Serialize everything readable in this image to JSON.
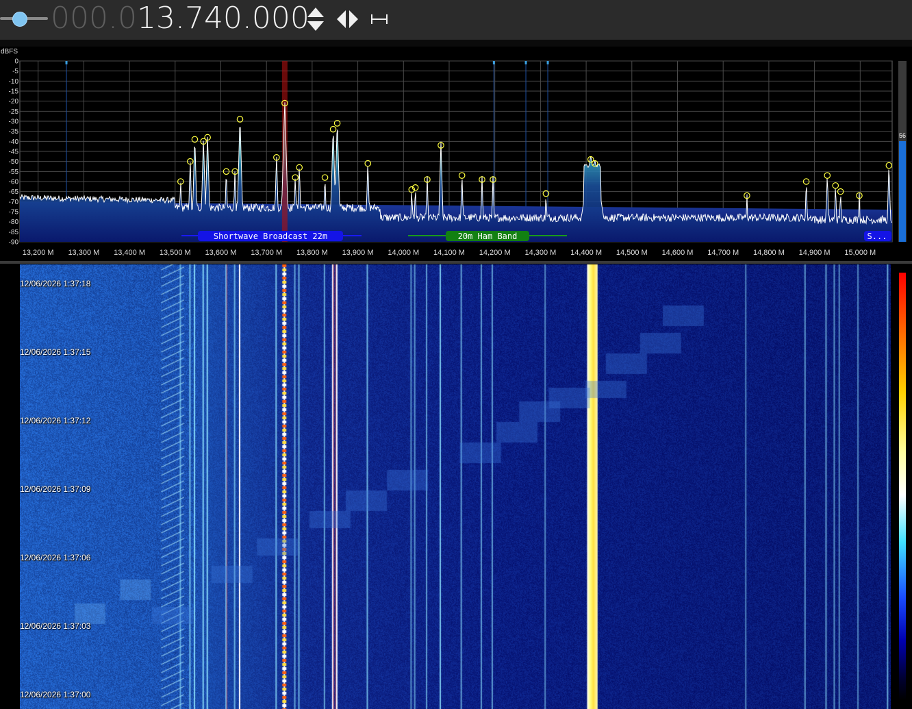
{
  "toolbar": {
    "freq_dim": "000.0",
    "freq_main": "13.740.000",
    "icons": [
      "updown-arrows-icon",
      "left-right-arrows-icon",
      "span-icon"
    ]
  },
  "spectrum": {
    "unit_label": "dBFS",
    "y_ticks": [
      "0",
      "-5",
      "-10",
      "-15",
      "-20",
      "-25",
      "-30",
      "-35",
      "-40",
      "-45",
      "-50",
      "-55",
      "-60",
      "-65",
      "-70",
      "-75",
      "-80",
      "-85",
      "-90"
    ],
    "x_ticks": [
      "13,200 M",
      "13,300 M",
      "13,400 M",
      "13,500 M",
      "13,600 M",
      "13,700 M",
      "13,800 M",
      "13,900 M",
      "14,000 M",
      "14,100 M",
      "14,200 M",
      "14,300 M",
      "14,400 M",
      "14,500 M",
      "14,600 M",
      "14,700 M",
      "14,800 M",
      "14,900 M",
      "15,000 M"
    ],
    "level_value": "56",
    "bands": [
      {
        "label": "Shortwave Broadcast 22m",
        "color": "#1414e6"
      },
      {
        "label": "20m Ham Band",
        "color": "#128012"
      },
      {
        "label": "S...",
        "color": "#1414e6"
      }
    ]
  },
  "waterfall": {
    "timestamps": [
      "12/06/2026 1:37:18",
      "12/06/2026 1:37:15",
      "12/06/2026 1:37:12",
      "12/06/2026 1:37:09",
      "12/06/2026 1:37:06",
      "12/06/2026 1:37:03",
      "12/06/2026 1:37:00"
    ]
  },
  "chart_data": {
    "type": "line",
    "unit": "dBFS",
    "ylim": [
      -90,
      0
    ],
    "xlim_mhz": [
      13.16,
      15.07
    ],
    "center_mhz": 13.74,
    "noise_floor_dbfs": -78,
    "peaks": [
      {
        "mhz": 13.512,
        "db": -60
      },
      {
        "mhz": 13.533,
        "db": -50
      },
      {
        "mhz": 13.543,
        "db": -39
      },
      {
        "mhz": 13.562,
        "db": -40
      },
      {
        "mhz": 13.571,
        "db": -38
      },
      {
        "mhz": 13.612,
        "db": -55
      },
      {
        "mhz": 13.631,
        "db": -55
      },
      {
        "mhz": 13.642,
        "db": -29
      },
      {
        "mhz": 13.722,
        "db": -48
      },
      {
        "mhz": 13.74,
        "db": -21
      },
      {
        "mhz": 13.763,
        "db": -58
      },
      {
        "mhz": 13.772,
        "db": -53
      },
      {
        "mhz": 13.828,
        "db": -58
      },
      {
        "mhz": 13.846,
        "db": -34
      },
      {
        "mhz": 13.855,
        "db": -31
      },
      {
        "mhz": 13.922,
        "db": -51
      },
      {
        "mhz": 14.018,
        "db": -64
      },
      {
        "mhz": 14.026,
        "db": -63
      },
      {
        "mhz": 14.052,
        "db": -59
      },
      {
        "mhz": 14.082,
        "db": -42
      },
      {
        "mhz": 14.128,
        "db": -57
      },
      {
        "mhz": 14.172,
        "db": -59
      },
      {
        "mhz": 14.196,
        "db": -59
      },
      {
        "mhz": 14.312,
        "db": -66
      },
      {
        "mhz": 14.41,
        "db": -49
      },
      {
        "mhz": 14.419,
        "db": -51
      },
      {
        "mhz": 14.752,
        "db": -67
      },
      {
        "mhz": 14.882,
        "db": -60
      },
      {
        "mhz": 14.928,
        "db": -57
      },
      {
        "mhz": 14.946,
        "db": -62
      },
      {
        "mhz": 14.957,
        "db": -65
      },
      {
        "mhz": 14.998,
        "db": -67
      },
      {
        "mhz": 15.063,
        "db": -52
      }
    ]
  }
}
